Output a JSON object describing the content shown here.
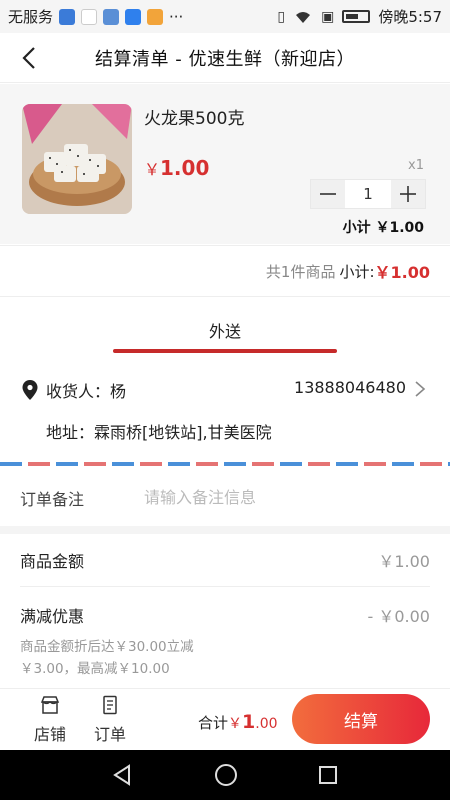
{
  "status_bar": {
    "carrier": "无服务",
    "more": "···",
    "time": "傍晚5:57"
  },
  "nav": {
    "title": "结算清单 - 优速生鲜（新迎店）"
  },
  "product": {
    "name": "火龙果500克",
    "price_symbol": "￥",
    "price": "1.00",
    "quantity_label": "x1",
    "quantity": "1",
    "subtotal": "小计 ￥1.00"
  },
  "summary": {
    "count_text": "共1件商品",
    "subtotal_label": "小计:",
    "subtotal_amount": "￥1.00"
  },
  "delivery": {
    "tab_label": "外送"
  },
  "address": {
    "receiver": "收货人：杨",
    "phone": "13888046480",
    "address": "地址：霖雨桥[地铁站],甘美医院"
  },
  "remark": {
    "label": "订单备注",
    "placeholder": "请输入备注信息"
  },
  "fees": {
    "goods_label": "商品金额",
    "goods_value": "￥1.00",
    "discount_label": "满减优惠",
    "discount_value": "- ￥0.00",
    "discount_note_line1": "商品金额折后达￥30.00立减",
    "discount_note_line2": "￥3.00，最高减￥10.00"
  },
  "bottom_bar": {
    "shop_label": "店铺",
    "orders_label": "订单",
    "total_label": "合计",
    "total_symbol": "￥",
    "total_amount": "1",
    "total_decimal": ".00",
    "checkout_label": "结算"
  },
  "colors": {
    "accent_red": "#d63030",
    "checkout_gradient_start": "#f26d3d",
    "checkout_gradient_end": "#e7283a"
  }
}
